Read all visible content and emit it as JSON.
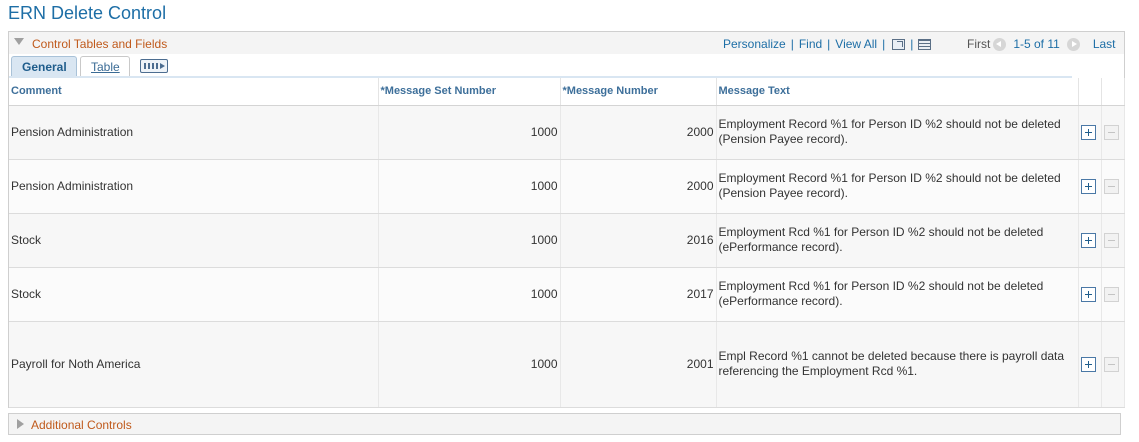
{
  "page": {
    "title": "ERN Delete Control"
  },
  "grid": {
    "title": "Control Tables and Fields",
    "links": {
      "personalize": "Personalize",
      "find": "Find",
      "view_all": "View All",
      "sep": "|"
    },
    "pager": {
      "first": "First",
      "range": "1-5 of 11",
      "last": "Last"
    },
    "tabs": {
      "general": "General",
      "table": "Table"
    },
    "columns": {
      "comment": "Comment",
      "message_set_number": "*Message Set Number",
      "message_number": "*Message Number",
      "message_text": "Message Text"
    },
    "rows": [
      {
        "comment": "Pension Administration",
        "set": "1000",
        "number": "2000",
        "text": "Employment Record %1 for Person ID %2 should not be deleted (Pension Payee record)."
      },
      {
        "comment": "Pension Administration",
        "set": "1000",
        "number": "2000",
        "text": "Employment Record %1 for Person ID %2 should not be deleted (Pension Payee record)."
      },
      {
        "comment": "Stock",
        "set": "1000",
        "number": "2016",
        "text": "Employment Rcd %1 for Person ID %2 should not be deleted (ePerformance record)."
      },
      {
        "comment": "Stock",
        "set": "1000",
        "number": "2017",
        "text": "Employment Rcd %1 for Person ID %2 should not be deleted (ePerformance record)."
      },
      {
        "comment": "Payroll for Noth America",
        "set": "1000",
        "number": "2001",
        "text": "Empl Record %1 cannot be deleted because there is payroll data referencing the Employment Rcd %1."
      }
    ]
  },
  "additional": {
    "title": "Additional Controls"
  }
}
